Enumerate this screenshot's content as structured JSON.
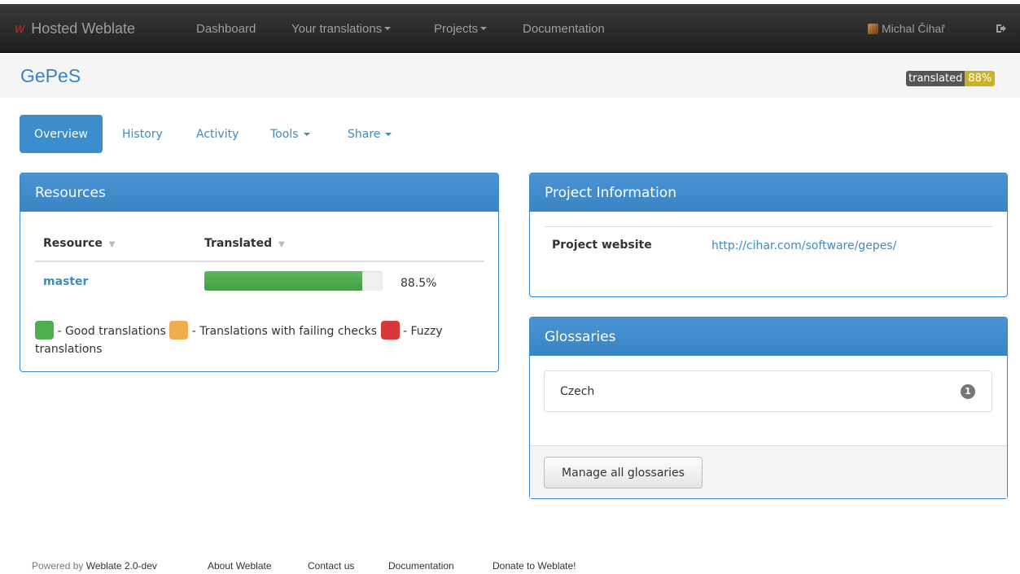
{
  "navbar": {
    "brand": "Hosted Weblate",
    "brand_logo": "W",
    "links": [
      "Dashboard",
      "Your translations",
      "Projects",
      "Documentation"
    ],
    "user_name": "Michal Čihař",
    "logout_icon": "logout-icon"
  },
  "project": {
    "title": "GePeS",
    "badge_label": "translated",
    "badge_value": "88%"
  },
  "tabs": [
    "Overview",
    "History",
    "Activity",
    "Tools",
    "Share"
  ],
  "resources": {
    "heading": "Resources",
    "columns": [
      "Resource",
      "Translated"
    ],
    "rows": [
      {
        "name": "master",
        "translated_percent": 88.5,
        "translated_label": "88.5%"
      }
    ],
    "legend": {
      "good": "- Good translations",
      "failing": "- Translations with failing checks",
      "fuzzy": "- Fuzzy translations",
      "colors": {
        "good": "#4cae4c",
        "failing": "#f0ad4e",
        "fuzzy": "#d9383a"
      }
    }
  },
  "project_info": {
    "heading": "Project Information",
    "key": "Project website",
    "value": "http://cihar.com/software/gepes/"
  },
  "glossaries": {
    "heading": "Glossaries",
    "items": [
      {
        "name": "Czech",
        "count": "1"
      }
    ],
    "button": "Manage all glossaries"
  },
  "footer": {
    "powered_prefix": "Powered by",
    "powered_name": "Weblate 2.0-dev",
    "links": [
      "About Weblate",
      "Contact us",
      "Documentation",
      "Donate to Weblate!"
    ]
  }
}
